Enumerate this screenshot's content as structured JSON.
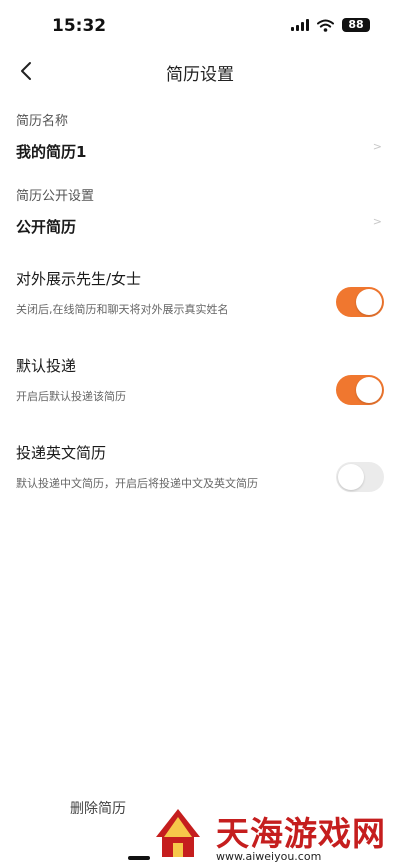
{
  "status_bar": {
    "time": "15:32",
    "battery": "88"
  },
  "nav": {
    "title": "简历设置",
    "back_icon": "chevron-left-icon"
  },
  "resume_name": {
    "caption": "简历名称",
    "value": "我的简历1",
    "chevron": ">"
  },
  "resume_visibility": {
    "caption": "简历公开设置",
    "value": "公开简历",
    "chevron": ">"
  },
  "toggles": [
    {
      "title": "对外展示先生/女士",
      "description": "关闭后,在线简历和聊天将对外展示真实姓名",
      "on": true
    },
    {
      "title": "默认投递",
      "description": "开启后默认投递该简历",
      "on": true
    },
    {
      "title": "投递英文简历",
      "description": "默认投递中文简历，开启后将投递中文及英文简历",
      "on": false
    }
  ],
  "bottom": {
    "delete_label": "删除简历"
  },
  "watermark": {
    "title": "天海游戏网",
    "url": "www.aiweiyou.com"
  },
  "colors": {
    "accent": "#f0772f",
    "switch_off": "#ebebeb",
    "watermark_red": "#c51e1e"
  }
}
